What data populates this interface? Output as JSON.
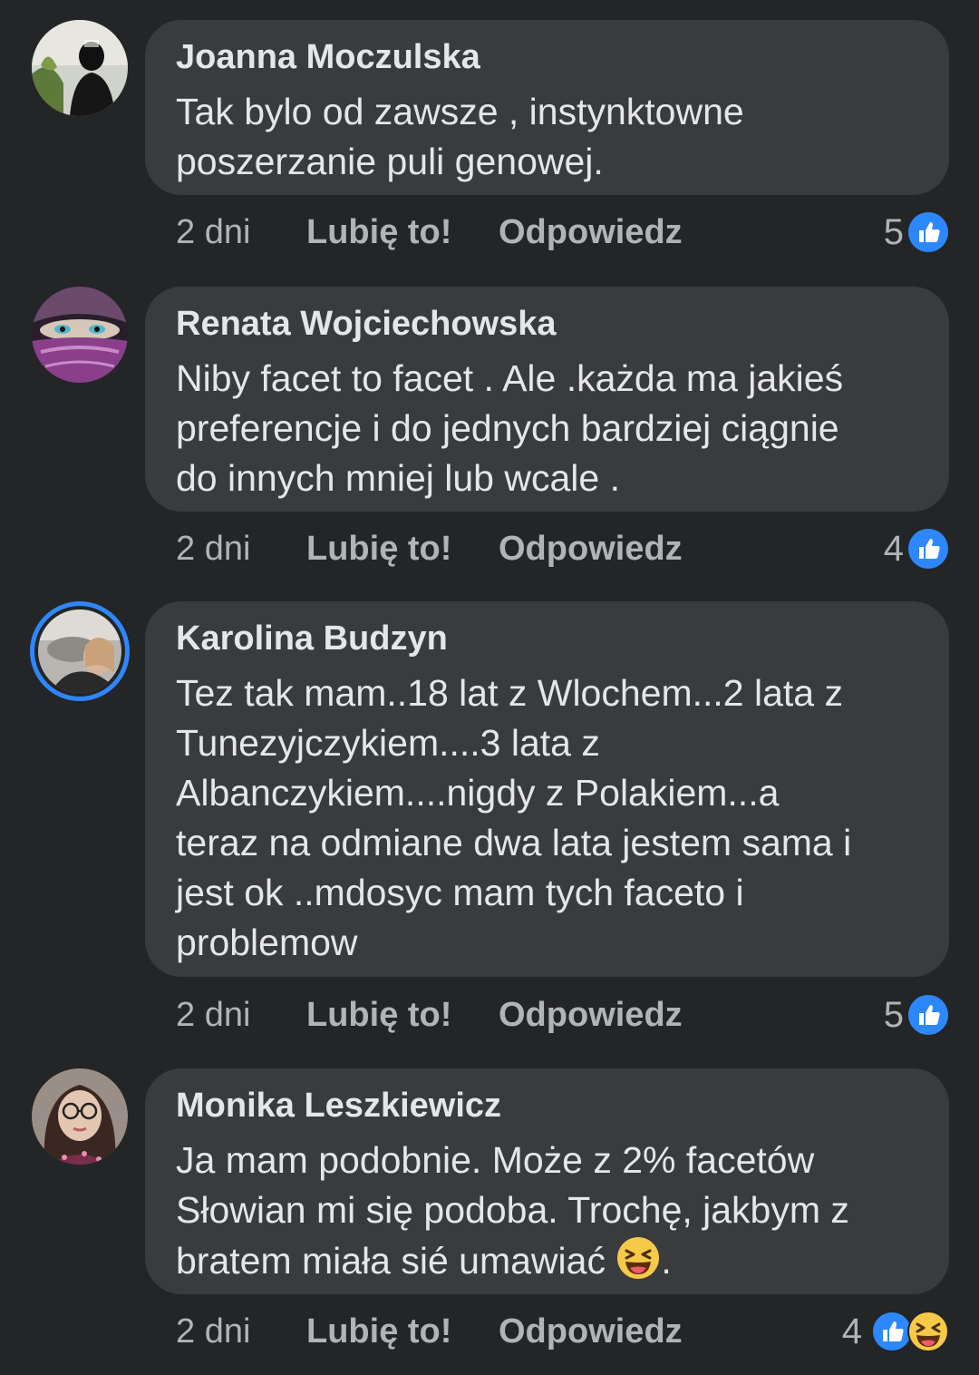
{
  "comments": [
    {
      "author": "Joanna Moczulska",
      "text": "Tak bylo od zawsze , instynktowne\nposzerzanie puli genowej.",
      "time": "2 dni",
      "like_label": "Lubię to!",
      "reply_label": "Odpowiedz",
      "reaction_count": "5",
      "reaction_icons": [
        "like-icon"
      ]
    },
    {
      "author": "Renata Wojciechowska",
      "text": "Niby facet to facet . Ale .każda ma jakieś\npreferencje i do jednych bardziej ciągnie\ndo innych mniej lub wcale .",
      "time": "2 dni",
      "like_label": "Lubię to!",
      "reply_label": "Odpowiedz",
      "reaction_count": "4",
      "reaction_icons": [
        "like-icon"
      ]
    },
    {
      "author": "Karolina Budzyn",
      "text": "Tez tak mam..18 lat z Wlochem...2 lata z\nTunezyjczykiem....3 lata z\nAlbanczykiem....nigdy z Polakiem...a\nteraz na odmiane dwa lata jestem sama i\njest ok ..mdosyc mam tych faceto i\nproblemow",
      "time": "2 dni",
      "like_label": "Lubię to!",
      "reply_label": "Odpowiedz",
      "reaction_count": "5",
      "reaction_icons": [
        "like-icon"
      ],
      "story_ring": true
    },
    {
      "author": "Monika Leszkiewicz",
      "text_before_emoji": "Ja mam podobnie. Może z 2% facetów\nSłowian mi się podoba. Trochę, jakbym z\nbratem miała sié umawiać ",
      "text_after_emoji": ".",
      "inline_emoji": "laughing-emoji",
      "time": "2 dni",
      "like_label": "Lubię to!",
      "reply_label": "Odpowiedz",
      "reaction_count": "4",
      "reaction_icons": [
        "like-icon",
        "haha-icon"
      ]
    }
  ],
  "colors": {
    "background": "#242526",
    "bubble": "#3a3b3c",
    "text": "#e4e6eb",
    "secondary_text": "#b0b3b8",
    "like_blue": "#2d88ff",
    "haha_yellow": "#f7c948"
  }
}
